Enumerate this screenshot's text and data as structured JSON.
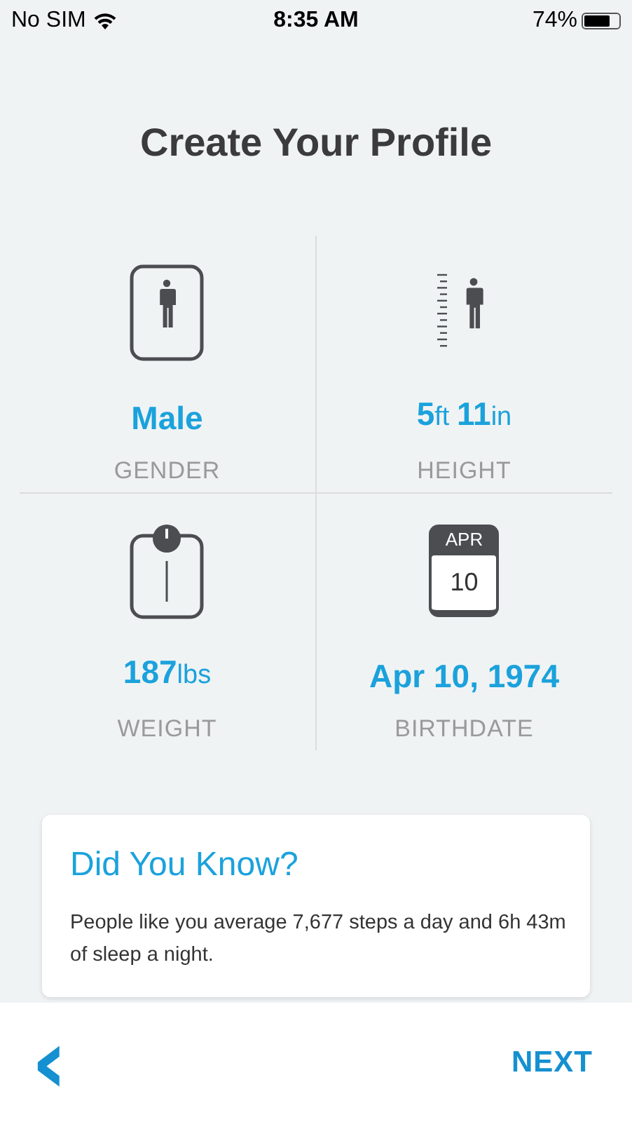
{
  "status_bar": {
    "carrier": "No SIM",
    "time": "8:35 AM",
    "battery": "74%"
  },
  "title": "Create Your Profile",
  "tile_rows": [
    [
      {
        "kind": "gender",
        "value": "Male",
        "label": "GENDER"
      },
      {
        "kind": "height",
        "value": "**5**ft **11**in",
        "label": "HEIGHT"
      }
    ],
    [
      {
        "kind": "weight",
        "value": "**187**lbs",
        "label": "WEIGHT"
      },
      {
        "kind": "birthdate",
        "value": "Apr 10, 1974",
        "label": "BIRTHDATE",
        "calendar_month": "APR",
        "calendar_day": "10"
      }
    ]
  ],
  "tip": {
    "title": "Did You Know?",
    "text": "People like you average 7,677 steps a day and 6h 43m of sleep a night."
  },
  "footer": {
    "back": "‹",
    "next": "NEXT"
  }
}
